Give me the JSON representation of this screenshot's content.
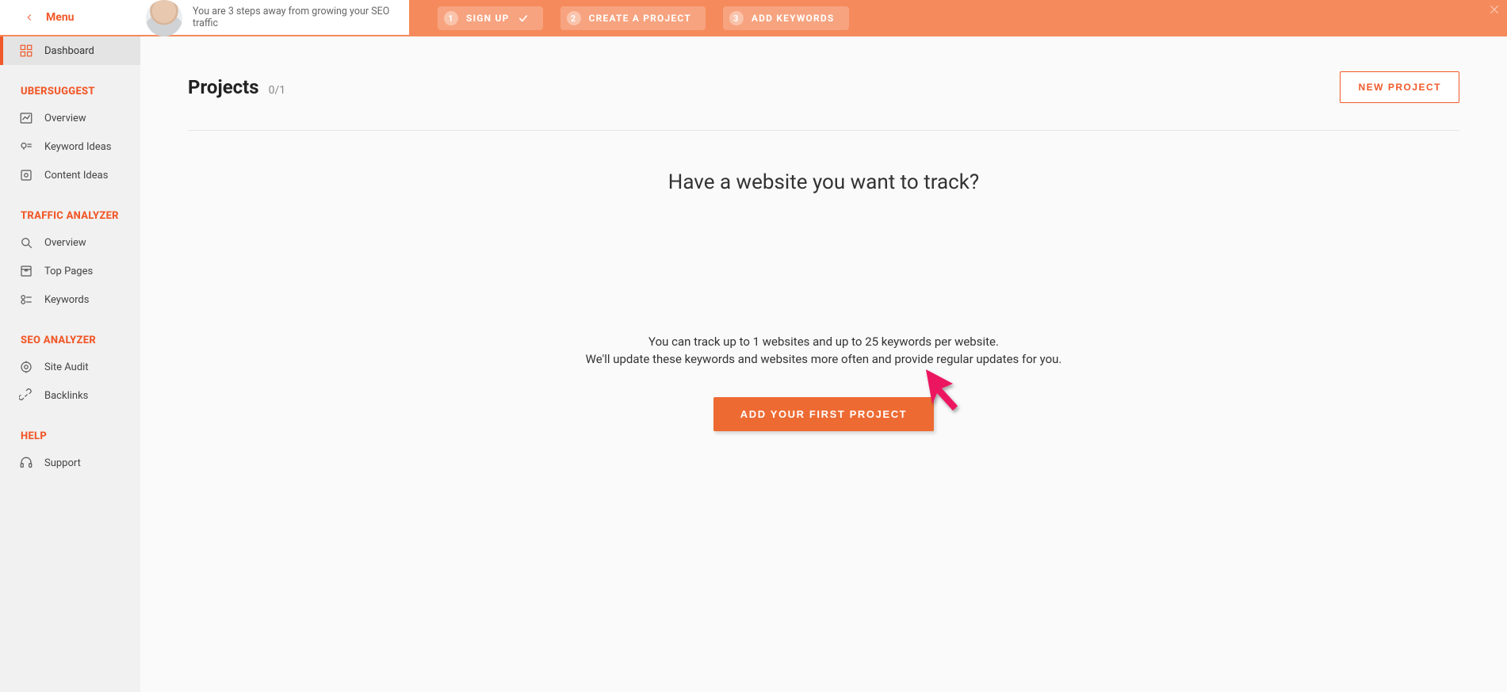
{
  "topbar": {
    "menu_label": "Menu",
    "steps_message": "You are 3 steps away from growing your SEO traffic",
    "steps": [
      {
        "num": "1",
        "label": "SIGN UP",
        "done": true
      },
      {
        "num": "2",
        "label": "CREATE A PROJECT",
        "done": false
      },
      {
        "num": "3",
        "label": "ADD KEYWORDS",
        "done": false
      }
    ]
  },
  "sidebar": {
    "dashboard_label": "Dashboard",
    "groups": [
      {
        "heading": "UBERSUGGEST",
        "items": [
          {
            "label": "Overview",
            "icon": "chart"
          },
          {
            "label": "Keyword Ideas",
            "icon": "bulb"
          },
          {
            "label": "Content Ideas",
            "icon": "content"
          }
        ]
      },
      {
        "heading": "TRAFFIC ANALYZER",
        "items": [
          {
            "label": "Overview",
            "icon": "magnify"
          },
          {
            "label": "Top Pages",
            "icon": "pages"
          },
          {
            "label": "Keywords",
            "icon": "keywords"
          }
        ]
      },
      {
        "heading": "SEO ANALYZER",
        "items": [
          {
            "label": "Site Audit",
            "icon": "audit"
          },
          {
            "label": "Backlinks",
            "icon": "link"
          }
        ]
      },
      {
        "heading": "HELP",
        "items": [
          {
            "label": "Support",
            "icon": "support"
          }
        ]
      }
    ]
  },
  "main": {
    "projects_label": "Projects",
    "projects_count": "0/1",
    "new_project_label": "NEW PROJECT",
    "empty_heading": "Have a website you want to track?",
    "empty_desc_line1": "You can track up to 1 websites and up to 25 keywords per website.",
    "empty_desc_line2": "We'll update these keywords and websites more often and provide regular updates for you.",
    "add_first_label": "ADD YOUR FIRST PROJECT"
  },
  "colors": {
    "accent": "#f1592a",
    "topbar": "#f58a5c"
  }
}
